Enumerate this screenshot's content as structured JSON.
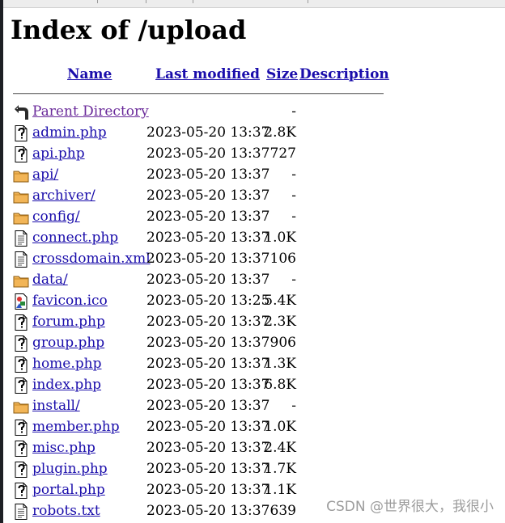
{
  "page": {
    "title": "Index of /upload",
    "watermark": "CSDN @世界很大，我很小"
  },
  "columns": {
    "name": "Name",
    "last_modified": "Last modified",
    "size": "Size",
    "description": "Description"
  },
  "rows": [
    {
      "name": "Parent Directory",
      "date": "",
      "size": "-",
      "icon": "back-icon",
      "visited": true
    },
    {
      "name": "admin.php",
      "date": "2023-05-20 13:37",
      "size": "2.8K",
      "icon": "unknown-file-icon"
    },
    {
      "name": "api.php",
      "date": "2023-05-20 13:37",
      "size": "727",
      "icon": "unknown-file-icon"
    },
    {
      "name": "api/",
      "date": "2023-05-20 13:37",
      "size": "-",
      "icon": "folder-icon"
    },
    {
      "name": "archiver/",
      "date": "2023-05-20 13:37",
      "size": "-",
      "icon": "folder-icon"
    },
    {
      "name": "config/",
      "date": "2023-05-20 13:37",
      "size": "-",
      "icon": "folder-icon"
    },
    {
      "name": "connect.php",
      "date": "2023-05-20 13:37",
      "size": "1.0K",
      "icon": "text-file-icon"
    },
    {
      "name": "crossdomain.xml",
      "date": "2023-05-20 13:37",
      "size": "106",
      "icon": "text-file-icon"
    },
    {
      "name": "data/",
      "date": "2023-05-20 13:37",
      "size": "-",
      "icon": "folder-icon"
    },
    {
      "name": "favicon.ico",
      "date": "2023-05-20 13:25",
      "size": "5.4K",
      "icon": "image-file-icon"
    },
    {
      "name": "forum.php",
      "date": "2023-05-20 13:37",
      "size": "2.3K",
      "icon": "unknown-file-icon"
    },
    {
      "name": "group.php",
      "date": "2023-05-20 13:37",
      "size": "906",
      "icon": "unknown-file-icon"
    },
    {
      "name": "home.php",
      "date": "2023-05-20 13:37",
      "size": "1.3K",
      "icon": "unknown-file-icon"
    },
    {
      "name": "index.php",
      "date": "2023-05-20 13:37",
      "size": "6.8K",
      "icon": "unknown-file-icon"
    },
    {
      "name": "install/",
      "date": "2023-05-20 13:37",
      "size": "-",
      "icon": "folder-icon"
    },
    {
      "name": "member.php",
      "date": "2023-05-20 13:37",
      "size": "1.0K",
      "icon": "unknown-file-icon"
    },
    {
      "name": "misc.php",
      "date": "2023-05-20 13:37",
      "size": "2.4K",
      "icon": "unknown-file-icon"
    },
    {
      "name": "plugin.php",
      "date": "2023-05-20 13:37",
      "size": "1.7K",
      "icon": "unknown-file-icon"
    },
    {
      "name": "portal.php",
      "date": "2023-05-20 13:37",
      "size": "1.1K",
      "icon": "unknown-file-icon"
    },
    {
      "name": "robots.txt",
      "date": "2023-05-20 13:37",
      "size": "639",
      "icon": "text-file-icon"
    }
  ]
}
